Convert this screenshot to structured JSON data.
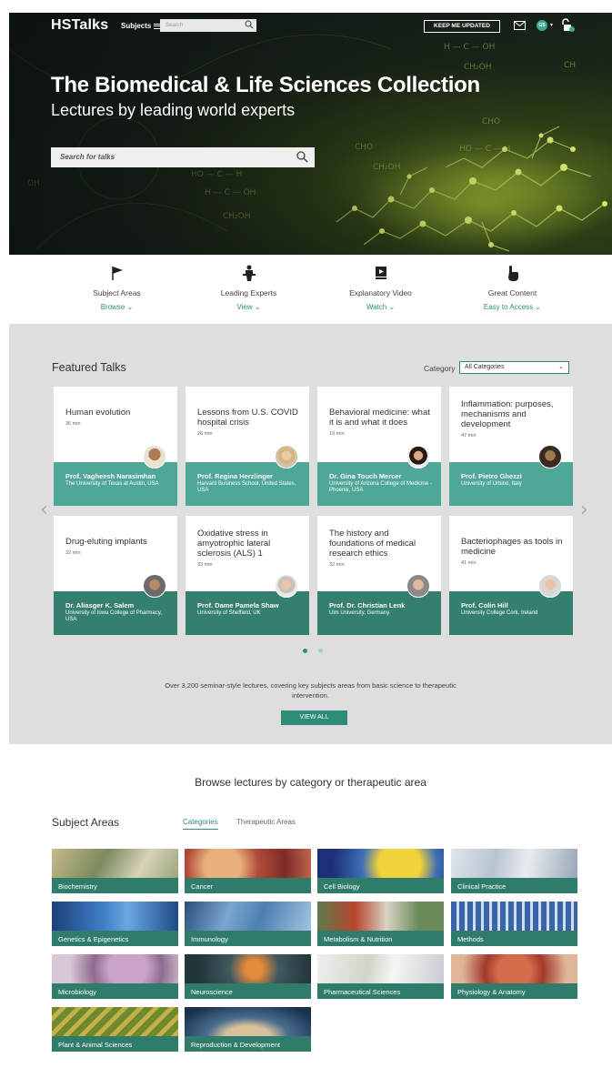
{
  "header": {
    "logo": "HSTalks",
    "subjects_label": "Subjects",
    "search_placeholder": "Search",
    "keep_updated": "KEEP ME UPDATED",
    "user_initials": "GS"
  },
  "hero": {
    "title": "The Biomedical & Life Sciences Collection",
    "subtitle": "Lectures by leading world experts",
    "search_placeholder": "Search for talks"
  },
  "features": [
    {
      "label": "Subject Areas",
      "action": "Browse",
      "icon": "flag-icon"
    },
    {
      "label": "Leading Experts",
      "action": "View",
      "icon": "lecturer-icon"
    },
    {
      "label": "Explanatory Video",
      "action": "Watch",
      "icon": "video-icon"
    },
    {
      "label": "Great Content",
      "action": "Easy to Access",
      "icon": "pointer-hand-icon"
    }
  ],
  "featured": {
    "heading": "Featured Talks",
    "category_label": "Category",
    "category_value": "All Categories",
    "talks": [
      {
        "title": "Human evolution",
        "duration": "36 min",
        "speaker": "Prof. Vagheesh Narasimhan",
        "affiliation": "The University of Texas at Austin, USA"
      },
      {
        "title": "Lessons from U.S. COVID hospital crisis",
        "duration": "26 min",
        "speaker": "Prof. Regina Herzlinger",
        "affiliation": "Harvard Business School, United States, USA"
      },
      {
        "title": "Behavioral medicine: what it is and what it does",
        "duration": "19 min",
        "speaker": "Dr. Gina Touch Mercer",
        "affiliation": "University of Arizona College of Medicine - Phoenix, USA"
      },
      {
        "title": "Inflammation: purposes, mechanisms and development",
        "duration": "47 min",
        "speaker": "Prof. Pietro Ghezzi",
        "affiliation": "University of Urbino, Italy"
      },
      {
        "title": "Drug-eluting implants",
        "duration": "32 min",
        "speaker": "Dr. Aliasger K. Salem",
        "affiliation": "University of Iowa College of Pharmacy, USA"
      },
      {
        "title": "Oxidative stress in amyotrophic lateral sclerosis (ALS) 1",
        "duration": "33 min",
        "speaker": "Prof. Dame Pamela Shaw",
        "affiliation": "University of Sheffield, UK"
      },
      {
        "title": "The history and foundations of medical research ethics",
        "duration": "32 min",
        "speaker": "Prof. Dr. Christian Lenk",
        "affiliation": "Ulm University, Germany"
      },
      {
        "title": "Bacteriophages as tools in medicine",
        "duration": "41 min",
        "speaker": "Prof. Colin Hill",
        "affiliation": "University College Cork, Ireland"
      }
    ],
    "blurb": "Over 3,200 seminar-style lectures, covering key subjects areas from basic science to therapeutic intervention.",
    "view_all": "VIEW ALL"
  },
  "browse": {
    "title": "Browse lectures by category or therapeutic area",
    "heading": "Subject Areas",
    "tabs": [
      "Categories",
      "Therapeutic Areas"
    ],
    "subjects": [
      "Biochemistry",
      "Cancer",
      "Cell Biology",
      "Clinical Practice",
      "Genetics & Epigenetics",
      "Immunology",
      "Metabolism & Nutrition",
      "Methods",
      "Microbiology",
      "Neuroscience",
      "Pharmaceutical Sciences",
      "Physiology & Anatomy",
      "Plant & Animal Sciences",
      "Reproduction & Development"
    ]
  },
  "colors": {
    "accent": "#2e8c78",
    "card_footer": "#4ea797",
    "tile_label": "#2f7c6b"
  }
}
